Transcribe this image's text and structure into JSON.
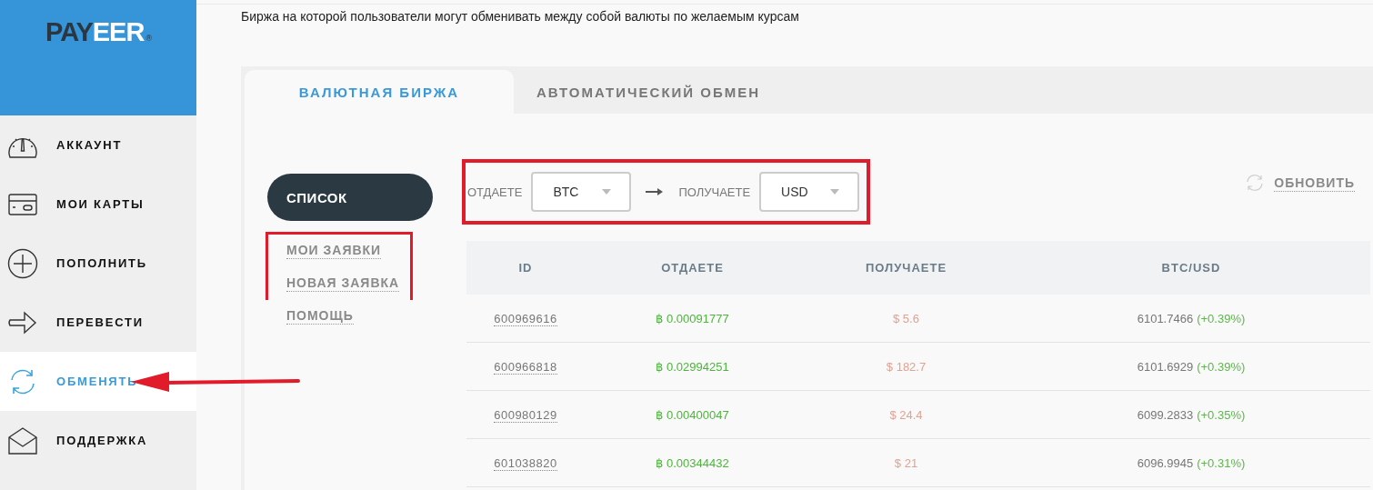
{
  "logo": {
    "dark": "PAY",
    "light": "EER",
    "mark": "®"
  },
  "sidebar": {
    "items": [
      {
        "label": "АККАУНТ",
        "selected": false,
        "pointed": false
      },
      {
        "label": "МОИ КАРТЫ",
        "selected": false,
        "pointed": false
      },
      {
        "label": "ПОПОЛНИТЬ",
        "selected": false,
        "pointed": false
      },
      {
        "label": "ПЕРЕВЕСТИ",
        "selected": false,
        "pointed": false
      },
      {
        "label": "ОБМЕНЯТЬ",
        "selected": true,
        "pointed": true
      },
      {
        "label": "ПОДДЕРЖКА",
        "selected": false,
        "pointed": false
      }
    ]
  },
  "description": "Биржа на которой пользователи могут обменивать между собой валюты по желаемым курсам",
  "tabs": [
    {
      "label": "ВАЛЮТНАЯ БИРЖА",
      "selected": true
    },
    {
      "label": "АВТОМАТИЧЕСКИЙ ОБМЕН",
      "selected": false
    }
  ],
  "menu": {
    "button": "СПИСОК",
    "links": [
      {
        "label": "МОИ ЗАЯВКИ",
        "highlighted": true
      },
      {
        "label": "НОВАЯ ЗАЯВКА",
        "highlighted": true
      },
      {
        "label": "ПОМОЩЬ",
        "highlighted": false
      }
    ]
  },
  "pair": {
    "highlighted": true,
    "give_label": "ОТДАЕТЕ",
    "give_value": "BTC",
    "get_label": "ПОЛУЧАЕТЕ",
    "get_value": "USD"
  },
  "refresh": "ОБНОВИТЬ",
  "table": {
    "columns": [
      "ID",
      "ОТДАЕТЕ",
      "ПОЛУЧАЕТЕ",
      "BTC/USD"
    ],
    "rows": [
      {
        "id": "600969616",
        "give": "฿ 0.00091777",
        "get": "$ 5.6",
        "rate": "6101.7466",
        "change": "(+0.39%)"
      },
      {
        "id": "600966818",
        "give": "฿ 0.02994251",
        "get": "$ 182.7",
        "rate": "6101.6929",
        "change": "(+0.39%)"
      },
      {
        "id": "600980129",
        "give": "฿ 0.00400047",
        "get": "$ 24.4",
        "rate": "6099.2833",
        "change": "(+0.35%)"
      },
      {
        "id": "601038820",
        "give": "฿ 0.00344432",
        "get": "$ 21",
        "rate": "6096.9945",
        "change": "(+0.31%)"
      }
    ]
  }
}
